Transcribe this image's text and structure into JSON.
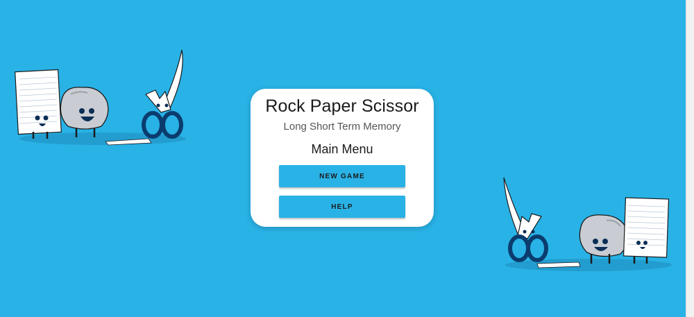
{
  "app": {
    "title": "Rock Paper Scissor",
    "subtitle": "Long Short Term Memory"
  },
  "menu": {
    "heading": "Main Menu",
    "new_game_label": "NEW GAME",
    "help_label": "HELP"
  },
  "colors": {
    "background": "#29b2e6",
    "card": "#ffffff",
    "button": "#29b2e6",
    "scissor_handle": "#0b3c6e"
  },
  "illustrations": {
    "left": [
      "paper-character",
      "rock-character",
      "scissors-character",
      "cut-paper-strip"
    ],
    "right": [
      "scissors-character",
      "cut-paper-strip",
      "rock-character",
      "paper-character"
    ]
  }
}
